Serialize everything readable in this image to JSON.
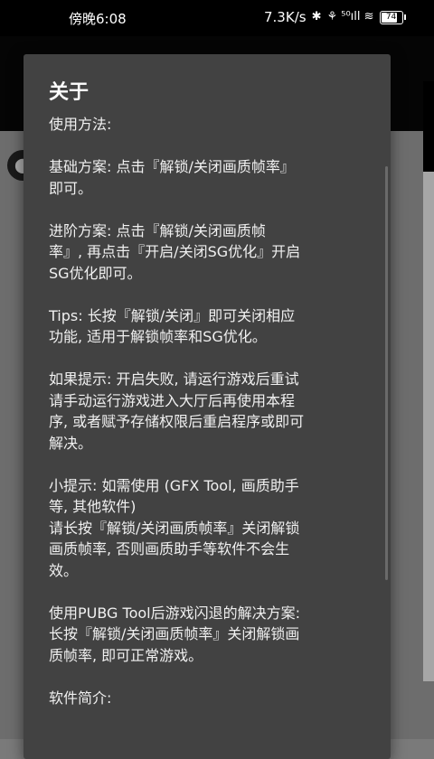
{
  "status_bar": {
    "time": "傍晚6:08",
    "network_speed": "7.3K/s",
    "bluetooth_icon": "✱",
    "signal_icons": "⚘ ⁵⁰ıll ≋",
    "battery": "74"
  },
  "dialog": {
    "title": "关于",
    "body": "使用方法:\n\n基础方案: 点击『解锁/关闭画质帧率』\n即可。\n\n进阶方案: 点击『解锁/关闭画质帧\n率』, 再点击『开启/关闭SG优化』开启\nSG优化即可。\n\nTips: 长按『解锁/关闭』即可关闭相应\n功能, 适用于解锁帧率和SG优化。\n\n如果提示: 开启失败, 请运行游戏后重试\n请手动运行游戏进入大厅后再使用本程\n序, 或者赋予存储权限后重启程序或即可\n解决。\n\n小提示: 如需使用 (GFX Tool, 画质助手\n等, 其他软件)\n请长按『解锁/关闭画质帧率』关闭解锁\n画质帧率, 否则画质助手等软件不会生\n效。\n\n使用PUBG Tool后游戏闪退的解决方案:\n长按『解锁/关闭画质帧率』关闭解锁画\n质帧率, 即可正常游戏。\n\n软件简介:"
  }
}
